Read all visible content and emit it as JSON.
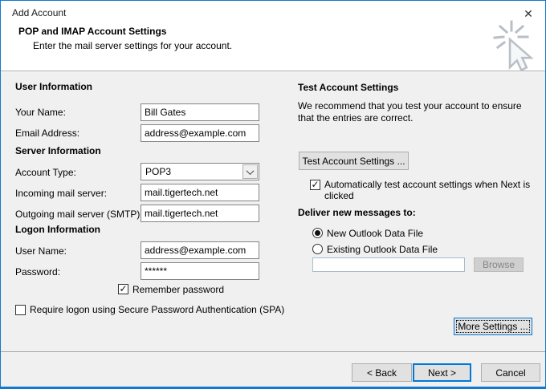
{
  "window": {
    "title": "Add Account"
  },
  "icons": {
    "close": "✕",
    "check": "✓"
  },
  "header": {
    "title": "POP and IMAP Account Settings",
    "subtitle": "Enter the mail server settings for your account."
  },
  "user_info": {
    "heading": "User Information",
    "your_name_label": "Your Name:",
    "your_name_value": "Bill Gates",
    "email_label": "Email Address:",
    "email_value": "address@example.com"
  },
  "server_info": {
    "heading": "Server Information",
    "account_type_label": "Account Type:",
    "account_type_value": "POP3",
    "incoming_label": "Incoming mail server:",
    "incoming_value": "mail.tigertech.net",
    "outgoing_label": "Outgoing mail server (SMTP):",
    "outgoing_value": "mail.tigertech.net"
  },
  "logon_info": {
    "heading": "Logon Information",
    "username_label": "User Name:",
    "username_value": "address@example.com",
    "password_label": "Password:",
    "password_value": "******",
    "remember_password_label": "Remember password",
    "spa_label": "Require logon using Secure Password Authentication (SPA)"
  },
  "test_section": {
    "heading": "Test Account Settings",
    "description": "We recommend that you test your account to ensure that the entries are correct.",
    "test_button_label": "Test Account Settings ...",
    "auto_test_label": "Automatically test account settings when Next is clicked"
  },
  "deliver_section": {
    "heading": "Deliver new messages to:",
    "new_data_file_label": "New Outlook Data File",
    "existing_data_file_label": "Existing Outlook Data File",
    "data_file_value": "",
    "browse_button_label": "Browse",
    "more_settings_label": "More Settings ..."
  },
  "footer": {
    "back_label": "< Back",
    "next_label": "Next >",
    "cancel_label": "Cancel"
  },
  "states": {
    "remember_password_checked": true,
    "auto_test_checked": true,
    "spa_checked": false,
    "delivery_selected": "New Outlook Data File",
    "data_file_field_enabled": false,
    "browse_enabled": false
  },
  "colors": {
    "accent": "#0078d7",
    "body_bg": "#f0f0f0",
    "header_bg": "#ffffff"
  }
}
